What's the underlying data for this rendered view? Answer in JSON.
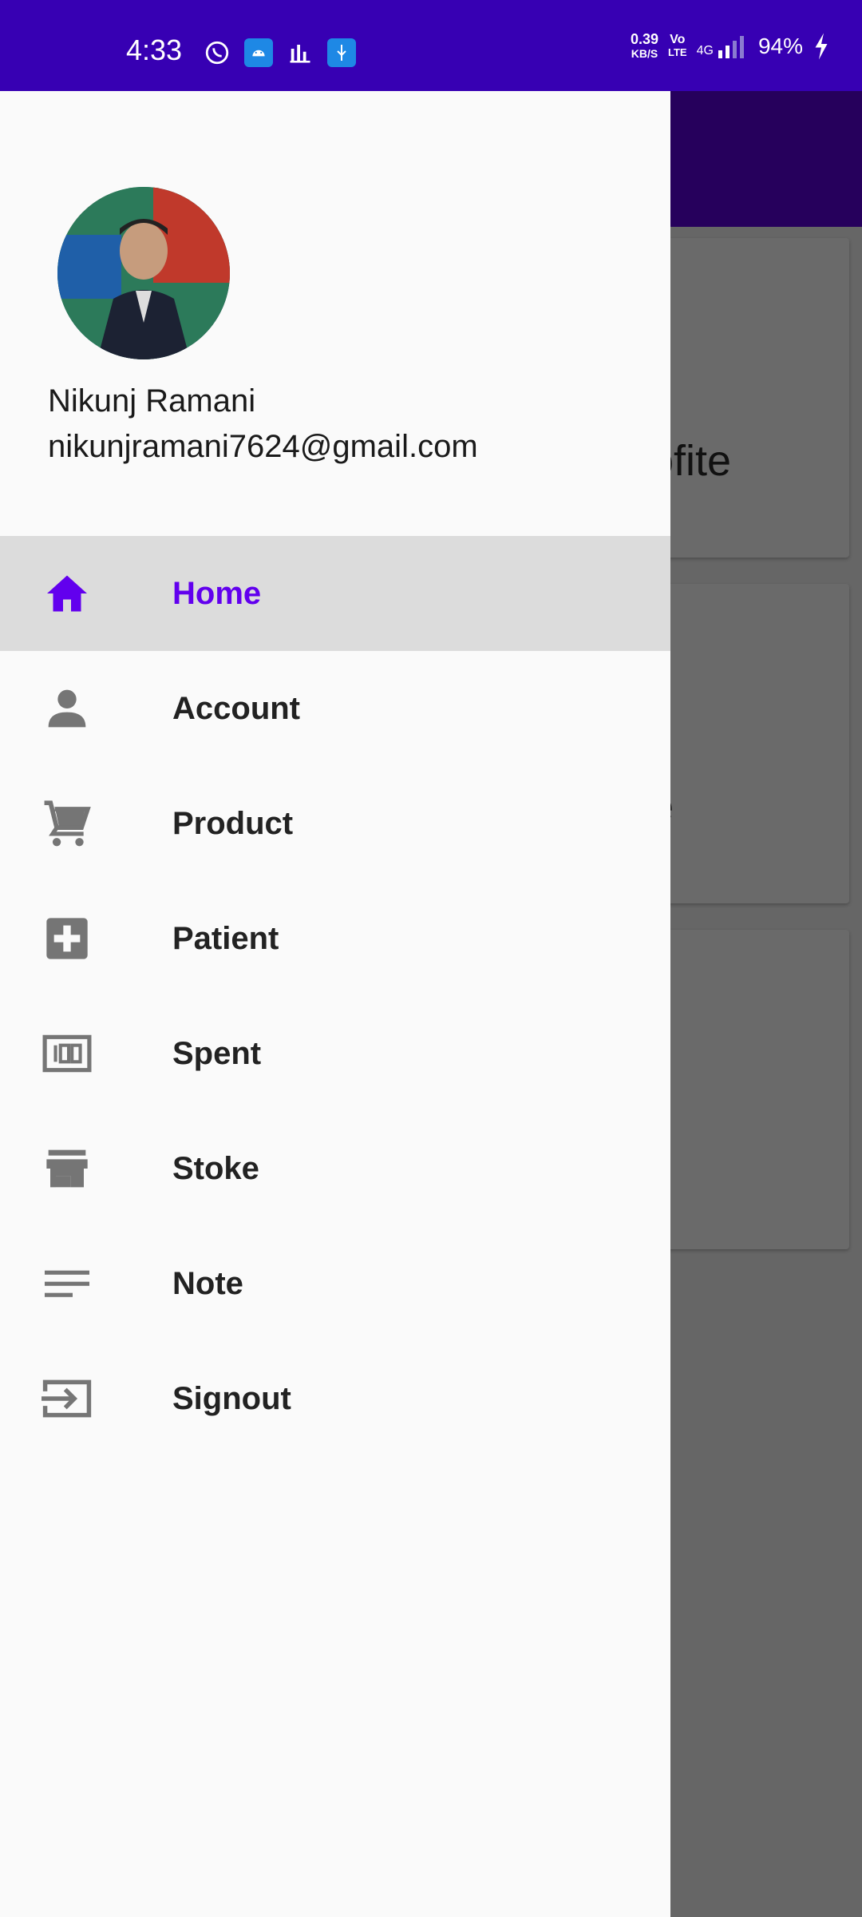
{
  "status_bar": {
    "time": "4:33",
    "net_speed_value": "0.39",
    "net_speed_unit": "KB/S",
    "volte_top": "Vo",
    "volte_bottom": "LTE",
    "network": "4G",
    "battery": "94%"
  },
  "background": {
    "card1_text": "ofite",
    "card2_text": "e"
  },
  "drawer": {
    "user_name": "Nikunj Ramani",
    "user_email": "nikunjramani7624@gmail.com",
    "menu": [
      {
        "label": "Home",
        "icon": "home-icon",
        "active": true
      },
      {
        "label": "Account",
        "icon": "person-icon",
        "active": false
      },
      {
        "label": "Product",
        "icon": "cart-icon",
        "active": false
      },
      {
        "label": "Patient",
        "icon": "medical-plus-icon",
        "active": false
      },
      {
        "label": "Spent",
        "icon": "money-100-icon",
        "active": false
      },
      {
        "label": "Stoke",
        "icon": "store-icon",
        "active": false
      },
      {
        "label": "Note",
        "icon": "notes-lines-icon",
        "active": false
      },
      {
        "label": "Signout",
        "icon": "sign-in-arrow-icon",
        "active": false
      }
    ]
  },
  "colors": {
    "status_bar": "#3700b3",
    "accent": "#6200ee",
    "icon_gray": "#757575"
  }
}
